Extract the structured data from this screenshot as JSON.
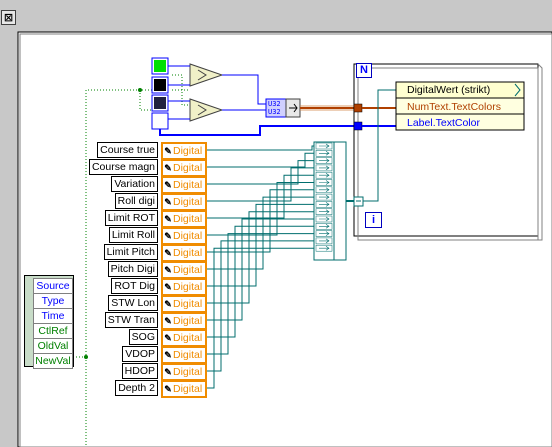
{
  "frame": {
    "close_glyph": "⊠"
  },
  "event_node": {
    "items": [
      {
        "label": "Source",
        "color": "blue"
      },
      {
        "label": "Type",
        "color": "blue"
      },
      {
        "label": "Time",
        "color": "blue"
      },
      {
        "label": "CtlRef",
        "color": "green"
      },
      {
        "label": "OldVal",
        "color": "green"
      },
      {
        "label": "NewVal",
        "color": "green"
      }
    ]
  },
  "controls": [
    {
      "label": "Course true",
      "ref": "Digital"
    },
    {
      "label": "Course magn",
      "ref": "Digital"
    },
    {
      "label": "Variation",
      "ref": "Digital"
    },
    {
      "label": "Roll digi",
      "ref": "Digital"
    },
    {
      "label": "Limit ROT",
      "ref": "Digital"
    },
    {
      "label": "Limit Roll",
      "ref": "Digital"
    },
    {
      "label": "Limit Pitch",
      "ref": "Digital"
    },
    {
      "label": "Pitch Digi",
      "ref": "Digital"
    },
    {
      "label": "ROT Dig",
      "ref": "Digital"
    },
    {
      "label": "STW Lon",
      "ref": "Digital"
    },
    {
      "label": "STW Tran",
      "ref": "Digital"
    },
    {
      "label": "SOG",
      "ref": "Digital"
    },
    {
      "label": "VDOP",
      "ref": "Digital"
    },
    {
      "label": "HDOP",
      "ref": "Digital"
    },
    {
      "label": "Depth 2",
      "ref": "Digital"
    }
  ],
  "for_loop": {
    "count_terminal": "N",
    "iteration_terminal": "i",
    "property_node": {
      "class_label": "DigitalWert (strikt)",
      "properties": [
        "NumText.TextColors",
        "Label.TextColor"
      ]
    }
  },
  "bundle_label": "U32",
  "colors": {
    "orange": "#f08c00",
    "blue": "#0000ff",
    "brown": "#b04000",
    "green_wire": "#008000",
    "teal_wire": "#006e6e"
  }
}
